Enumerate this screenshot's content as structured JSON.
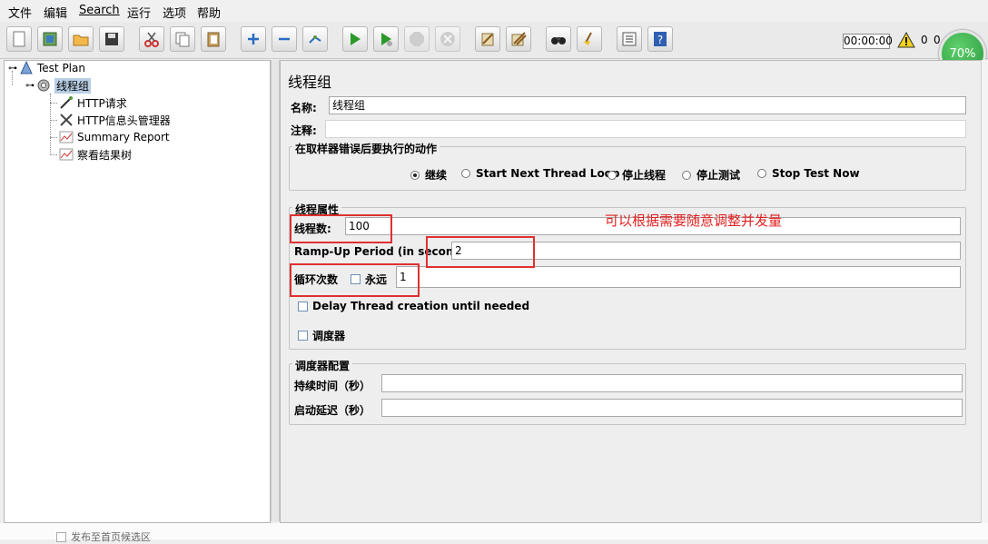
{
  "menu": {
    "items": [
      "文件",
      "编辑",
      "Search",
      "运行",
      "选项",
      "帮助"
    ]
  },
  "toolbar": {
    "timer": "00:00:00",
    "warning_count": "0",
    "second_count": "0",
    "progress_percent": "70%",
    "buttons": [
      "new-icon",
      "templates-icon",
      "open-icon",
      "save-icon",
      "cut-icon",
      "copy-icon",
      "paste-icon",
      "expand-icon",
      "collapse-icon",
      "toggle-icon",
      "start-icon",
      "start-no-pause-icon",
      "stop-icon",
      "shutdown-icon",
      "clear-icon",
      "clear-all-icon",
      "search-icon",
      "reset-search-icon",
      "function-helper-icon",
      "help-icon"
    ]
  },
  "tree": {
    "test_plan": "Test Plan",
    "thread_group": "线程组",
    "http_request": "HTTP请求",
    "header_manager": "HTTP信息头管理器",
    "summary_report": "Summary Report",
    "results_tree": "察看结果树"
  },
  "panel": {
    "title": "线程组",
    "name_label": "名称:",
    "name_value": "线程组",
    "comment_label": "注释:",
    "comment_value": "",
    "error_action": {
      "title": "在取样器错误后要执行的动作",
      "options": [
        "继续",
        "Start Next Thread Loop",
        "停止线程",
        "停止测试",
        "Stop Test Now"
      ],
      "selected": "继续"
    },
    "thread_props": {
      "title": "线程属性",
      "threads_label": "线程数:",
      "threads_value": "100",
      "rampup_label": "Ramp-Up Period (in seconds):",
      "rampup_value": "2",
      "loop_label": "循环次数",
      "forever_label": "永远",
      "loop_value": "1",
      "delay_label": "Delay Thread creation until needed",
      "scheduler_label": "调度器"
    },
    "scheduler_config": {
      "title": "调度器配置",
      "duration_label": "持续时间（秒）",
      "duration_value": "",
      "delay_label": "启动延迟（秒）",
      "delay_value": ""
    }
  },
  "annotation": "可以根据需要随意调整并发量",
  "bottom": {
    "checkbox_label": "发布至首页候选区"
  },
  "colors": {
    "annotation_red": "#e03030",
    "badge_green": "#2a9a3c",
    "selection_blue": "#b8cfe5"
  }
}
